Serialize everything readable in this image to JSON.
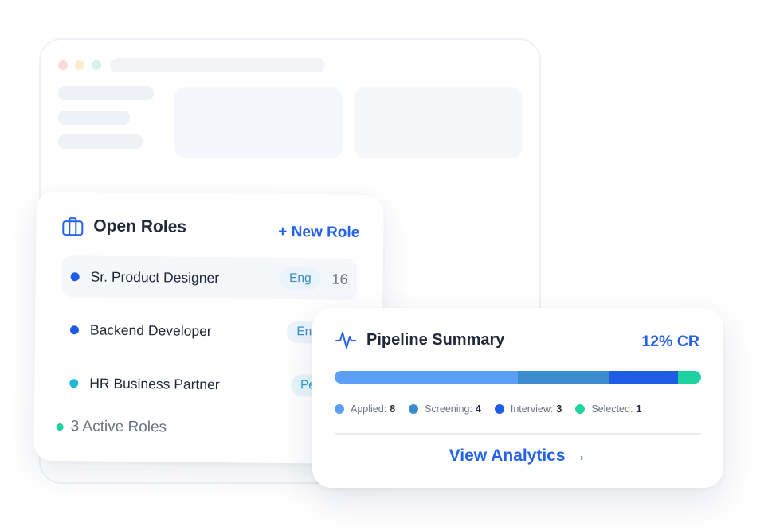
{
  "roles_card": {
    "title": "Open Roles",
    "new_role_label": "+ New Role",
    "roles": [
      {
        "name": "Sr. Product Designer",
        "department": "Eng",
        "count": "16",
        "dot_color": "#1f5ce6"
      },
      {
        "name": "Backend Developer",
        "department": "Eng",
        "count": "",
        "dot_color": "#1f5ce6"
      },
      {
        "name": "HR Business Partner",
        "department": "People",
        "count": "",
        "dot_color": "#1fb8d9"
      }
    ],
    "active_roles_label": "3 Active Roles"
  },
  "pipeline_card": {
    "title": "Pipeline Summary",
    "conversion_rate": "12% CR",
    "stages": [
      {
        "label": "Applied:",
        "value": 8,
        "color": "#5b9ef5"
      },
      {
        "label": "Screening:",
        "value": 4,
        "color": "#3a8ccf"
      },
      {
        "label": "Interview:",
        "value": 3,
        "color": "#1f5ce6"
      },
      {
        "label": "Selected:",
        "value": 1,
        "color": "#1fd3a0"
      }
    ],
    "view_analytics_label": "View Analytics →"
  },
  "colors": {
    "accent": "#2563eb",
    "active_dot": "#1fd3a0"
  }
}
